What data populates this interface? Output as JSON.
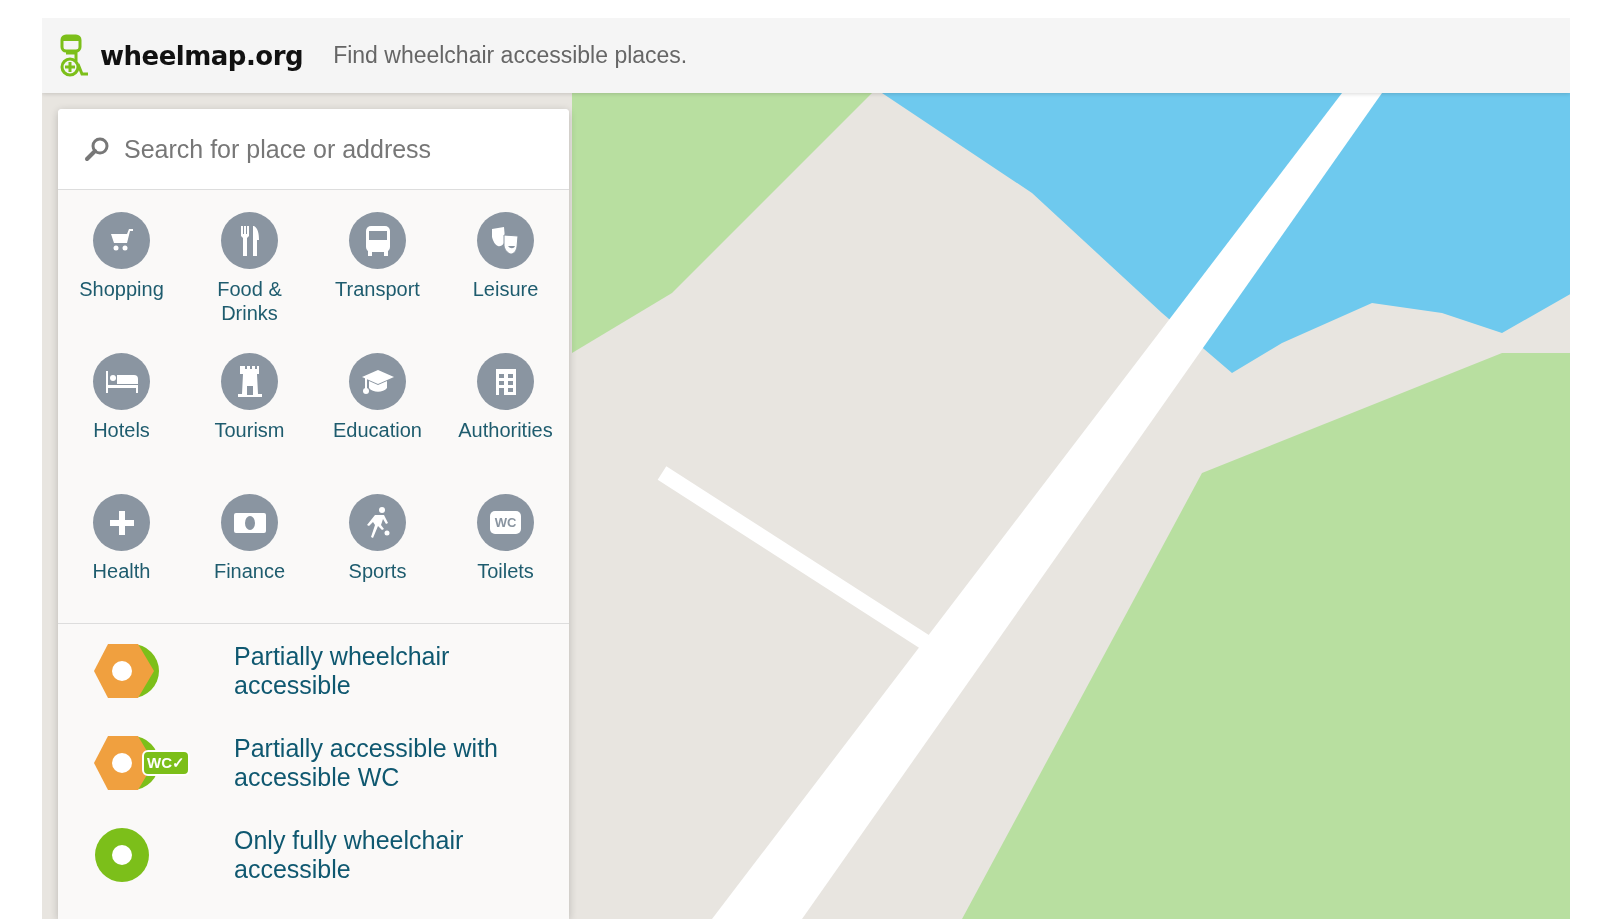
{
  "header": {
    "logo": "wheelmap.org",
    "tagline": "Find wheelchair accessible places."
  },
  "search": {
    "placeholder": "Search for place or address"
  },
  "categories": [
    {
      "label": "Shopping"
    },
    {
      "label": "Food & Drinks"
    },
    {
      "label": "Transport"
    },
    {
      "label": "Leisure"
    },
    {
      "label": "Hotels"
    },
    {
      "label": "Tourism"
    },
    {
      "label": "Education"
    },
    {
      "label": "Authorities"
    },
    {
      "label": "Health"
    },
    {
      "label": "Finance"
    },
    {
      "label": "Sports"
    },
    {
      "label": "Toilets",
      "icon_text": "WC"
    }
  ],
  "filters": [
    {
      "kind": "partial",
      "label": "Partially wheelchair accessible"
    },
    {
      "kind": "partial_wc",
      "label": "Partially accessible with accessible WC",
      "badge": "WC✓"
    },
    {
      "kind": "full",
      "label": "Only fully wheelchair accessible"
    }
  ]
}
